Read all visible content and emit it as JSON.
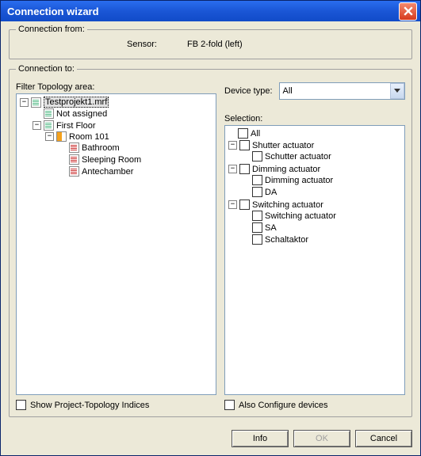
{
  "title": "Connection wizard",
  "connection_from": {
    "legend": "Connection from:",
    "sensor_label": "Sensor:",
    "sensor_value": "FB 2-fold  (left)"
  },
  "connection_to": {
    "legend": "Connection to:",
    "filter_label": "Filter Topology area:",
    "device_type_label": "Device type:",
    "device_type_value": "All",
    "selection_label": "Selection:",
    "show_indices_label": "Show Project-Topology Indices",
    "also_configure_label": "Also Configure devices"
  },
  "topology_tree": {
    "root": "Testprojekt1.mrf",
    "nodes": {
      "not_assigned": "Not assigned",
      "first_floor": "First Floor",
      "room101": "Room 101",
      "bathroom": "Bathroom",
      "sleeping": "Sleeping Room",
      "antechamber": "Antechamber"
    }
  },
  "selection_tree": {
    "all": "All",
    "shutter_act": "Shutter actuator",
    "schutter_act": "Schutter actuator",
    "dimming_act": "Dimming actuator",
    "dimming_act2": "Dimming actuator",
    "da": "DA",
    "switching_act": "Switching actuator",
    "switching_act2": "Switching actuator",
    "sa": "SA",
    "schaltaktor": "Schaltaktor"
  },
  "buttons": {
    "info": "Info",
    "ok": "OK",
    "cancel": "Cancel"
  }
}
